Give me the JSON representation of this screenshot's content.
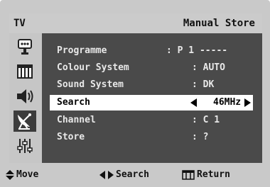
{
  "header": {
    "source": "TV",
    "title": "Manual Store"
  },
  "sidebar": {
    "icons": [
      "input-icon",
      "picture-icon",
      "sound-icon",
      "channel-icon",
      "setup-icon"
    ],
    "active": "channel-icon"
  },
  "menu": {
    "items": [
      {
        "label": "Programme",
        "value": ": P 1 -----"
      },
      {
        "label": "Colour System",
        "value": ": AUTO"
      },
      {
        "label": "Sound System",
        "value": ": DK"
      },
      {
        "label": "Search",
        "value": "46MHz",
        "selected": true
      },
      {
        "label": "Channel",
        "value": ": C 1"
      },
      {
        "label": "Store",
        "value": ": ?"
      }
    ]
  },
  "footer": {
    "move": "Move",
    "search": "Search",
    "return": "Return"
  },
  "colors": {
    "panel": "#4a4a4a",
    "sidebar": "#c6c6c6",
    "frame": "#c9c9c9",
    "selected_row": "#ffffff"
  }
}
